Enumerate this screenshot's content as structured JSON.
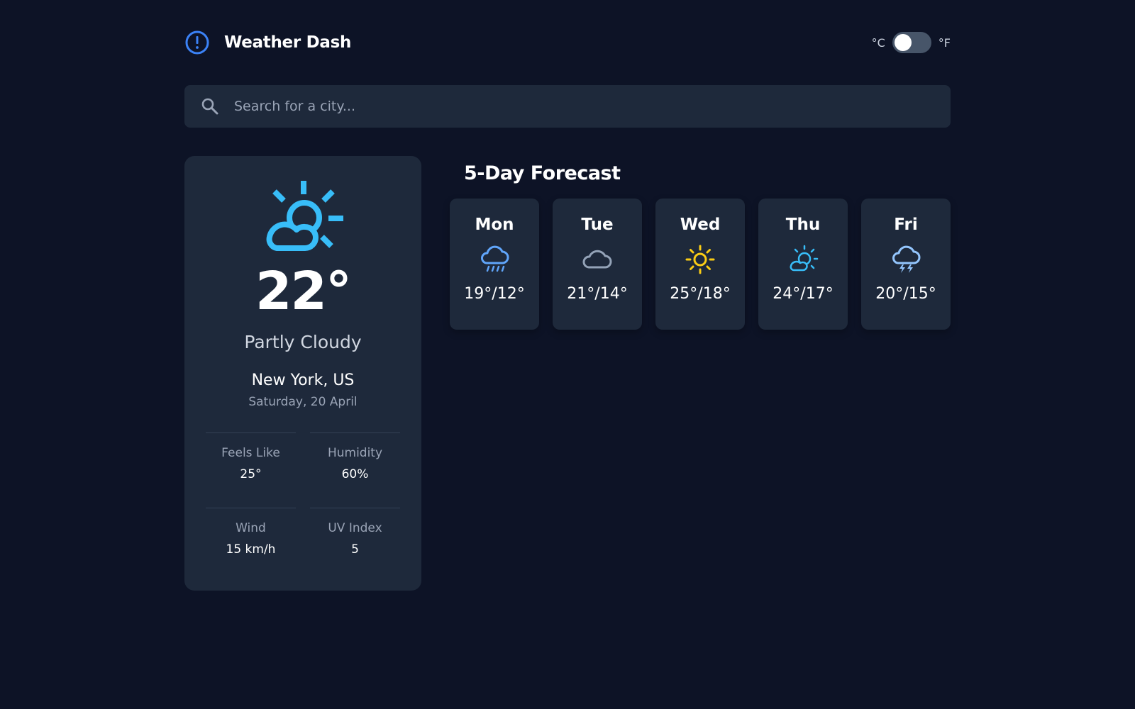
{
  "header": {
    "app_title": "Weather Dash",
    "brand_icon": "alert-circle-icon",
    "unit_celsius": "°C",
    "unit_fahrenheit": "°F",
    "selected_unit": "°C"
  },
  "search": {
    "placeholder": "Search for a city..."
  },
  "current": {
    "icon": "partly-cloudy-icon",
    "temperature": "22°",
    "condition": "Partly Cloudy",
    "location": "New York, US",
    "date": "Saturday, 20 April",
    "stats": [
      {
        "label": "Feels Like",
        "value": "25°"
      },
      {
        "label": "Humidity",
        "value": "60%"
      },
      {
        "label": "Wind",
        "value": "15 km/h"
      },
      {
        "label": "UV Index",
        "value": "5"
      }
    ]
  },
  "forecast": {
    "title": "5-Day Forecast",
    "days": [
      {
        "day": "Mon",
        "icon": "rain-icon",
        "temps": "19°/12°"
      },
      {
        "day": "Tue",
        "icon": "cloud-icon",
        "temps": "21°/14°"
      },
      {
        "day": "Wed",
        "icon": "sun-icon",
        "temps": "25°/18°"
      },
      {
        "day": "Thu",
        "icon": "partly-cloudy-icon",
        "temps": "24°/17°"
      },
      {
        "day": "Fri",
        "icon": "thunderstorm-icon",
        "temps": "20°/15°"
      }
    ]
  },
  "colors": {
    "background": "#0d1326",
    "card": "#1e293b",
    "accent_blue": "#38bdf8",
    "sun_yellow": "#facc15",
    "cloud_gray": "#94a3b8",
    "brand_blue": "#3b82f6"
  }
}
